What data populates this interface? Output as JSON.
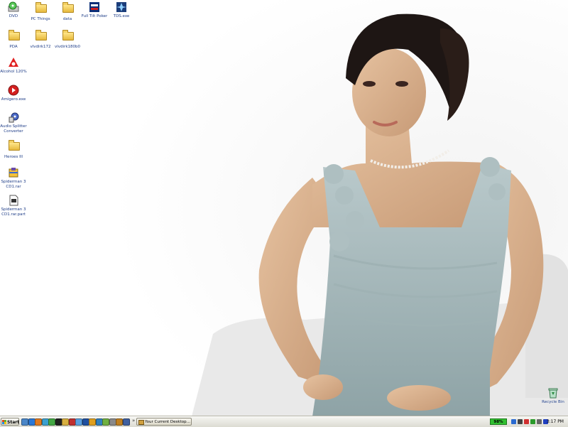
{
  "desktop": {
    "icons": [
      {
        "label": "DVD",
        "icon": "dvd-drive-icon"
      },
      {
        "label": "PC Things",
        "icon": "folder-icon"
      },
      {
        "label": "data",
        "icon": "folder-icon"
      },
      {
        "label": "Full Tilt Poker",
        "icon": "poker-app-icon"
      },
      {
        "label": "TDS.exe",
        "icon": "app-icon"
      },
      {
        "label": "PDA",
        "icon": "folder-icon"
      },
      {
        "label": "vlvdirk172",
        "icon": "folder-icon"
      },
      {
        "label": "vlvdirk180b0",
        "icon": "folder-icon"
      },
      {
        "label": "Alcohol 120%",
        "icon": "alcohol-120-icon"
      },
      {
        "label": "Amigero.exe",
        "icon": "media-player-icon"
      },
      {
        "label": "Audio Splitter Converter",
        "icon": "audio-converter-icon"
      },
      {
        "label": "Heroes III",
        "icon": "folder-icon"
      },
      {
        "label": "Spiderman 3 CD1.rar",
        "icon": "archive-icon"
      },
      {
        "label": "Spiderman 3 CD1.rar.part",
        "icon": "document-icon"
      },
      {
        "label": "Recycle Bin",
        "icon": "recycle-bin-icon"
      }
    ]
  },
  "taskbar": {
    "start_label": "Start",
    "quicklaunch": [
      {
        "name": "show-desktop-icon",
        "color": "#4a86c8"
      },
      {
        "name": "ie-icon",
        "color": "#2a78d8"
      },
      {
        "name": "firefox-icon",
        "color": "#e07a1f"
      },
      {
        "name": "media-icon",
        "color": "#3ba0d0"
      },
      {
        "name": "messenger-icon",
        "color": "#44a844"
      },
      {
        "name": "app-icon",
        "color": "#222222"
      },
      {
        "name": "explorer-icon",
        "color": "#d8b040"
      },
      {
        "name": "app-icon",
        "color": "#c03030"
      },
      {
        "name": "music-icon",
        "color": "#5aa0e0"
      },
      {
        "name": "app-icon",
        "color": "#2050a0"
      },
      {
        "name": "app-icon",
        "color": "#e0a020"
      },
      {
        "name": "app-icon",
        "color": "#3080c0"
      },
      {
        "name": "app-icon",
        "color": "#70b040"
      },
      {
        "name": "app-icon",
        "color": "#8a8a8a"
      },
      {
        "name": "app-icon",
        "color": "#c08020"
      },
      {
        "name": "app-icon",
        "color": "#4060a0"
      }
    ],
    "chevron": "»",
    "window_button": "Your Current Desktop...",
    "battery": "98%",
    "tray": [
      {
        "name": "network-icon",
        "color": "#2a6ad0"
      },
      {
        "name": "audio-icon",
        "color": "#444444"
      },
      {
        "name": "alcohol-icon",
        "color": "#d03030"
      },
      {
        "name": "app-icon",
        "color": "#2a9a2a"
      },
      {
        "name": "app-icon",
        "color": "#666666"
      },
      {
        "name": "media-icon",
        "color": "#2040c0"
      }
    ],
    "clock": "3:17 PM"
  }
}
